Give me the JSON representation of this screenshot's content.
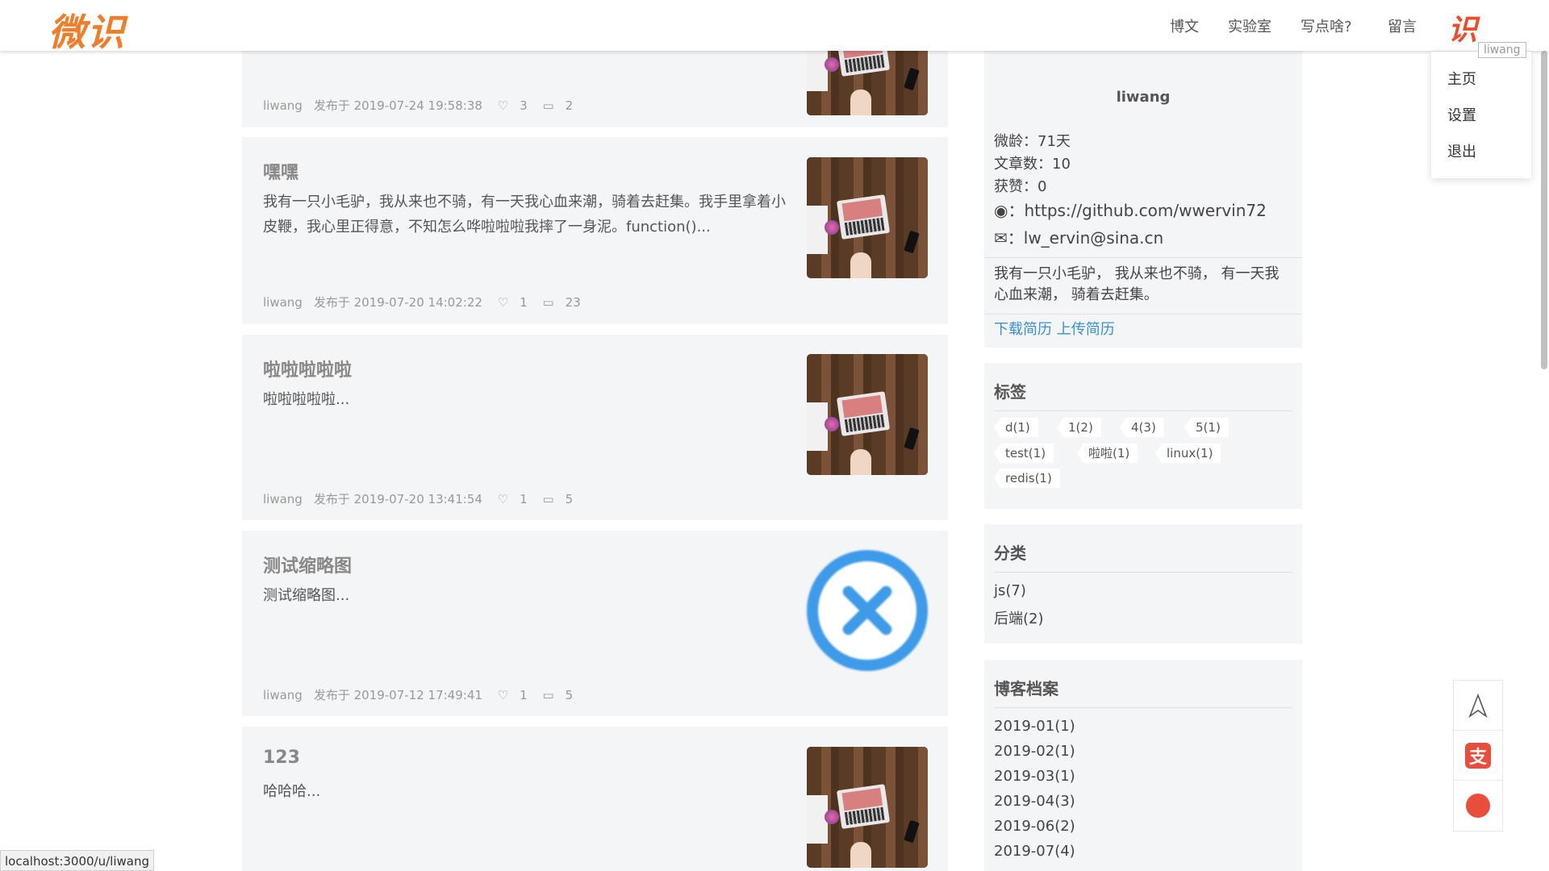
{
  "header": {
    "logo": "微识",
    "nav": [
      "博文",
      "实验室",
      "写点啥?",
      "留言"
    ],
    "avatar_glyph": "识",
    "tooltip": "liwang",
    "dropdown": [
      "主页",
      "设置",
      "退出"
    ]
  },
  "posts": [
    {
      "title": "",
      "summary": "",
      "meta": {
        "author": "liwang",
        "published": "发布于 2019-07-24 19:58:38",
        "likes": "3",
        "comments": "2"
      }
    },
    {
      "title": "嘿嘿",
      "summary": "我有一只小毛驴，我从来也不骑，有一天我心血来潮，骑着去赶集。我手里拿着小皮鞭，我心里正得意，不知怎么哗啦啦啦我摔了一身泥。function()...",
      "meta": {
        "author": "liwang",
        "published": "发布于 2019-07-20 14:02:22",
        "likes": "1",
        "comments": "23"
      }
    },
    {
      "title": "啦啦啦啦啦",
      "summary": "啦啦啦啦啦...",
      "meta": {
        "author": "liwang",
        "published": "发布于 2019-07-20 13:41:54",
        "likes": "1",
        "comments": "5"
      }
    },
    {
      "title": "测试缩略图",
      "summary": "测试缩略图...",
      "meta": {
        "author": "liwang",
        "published": "发布于 2019-07-12 17:49:41",
        "likes": "1",
        "comments": "5"
      }
    },
    {
      "title": "123",
      "summary": "哈哈哈...",
      "meta": {
        "author": "liwang",
        "published": "",
        "likes": "",
        "comments": ""
      }
    }
  ],
  "profile": {
    "name": "liwang",
    "age": "微龄：71天",
    "articles": "文章数：10",
    "likes": "获赞：0",
    "github": "https://github.com/wwervin72",
    "email": "lw_ervin@sina.cn",
    "bio": "我有一只小毛驴， 我从来也不骑， 有一天我心血来潮， 骑着去赶集。",
    "download_resume": "下载简历",
    "upload_resume": "上传简历"
  },
  "tags": {
    "title": "标签",
    "items": [
      "d(1)",
      "1(2)",
      "4(3)",
      "5(1)",
      "test(1)",
      "啦啦(1)",
      "linux(1)",
      "redis(1)"
    ]
  },
  "categories": {
    "title": "分类",
    "items": [
      "js(7)",
      "后端(2)"
    ]
  },
  "archive": {
    "title": "博客档案",
    "items": [
      "2019-01(1)",
      "2019-02(1)",
      "2019-03(1)",
      "2019-04(3)",
      "2019-06(2)",
      "2019-07(4)"
    ]
  },
  "float": {
    "alipay_glyph": "支"
  },
  "status_url": "localhost:3000/u/liwang"
}
